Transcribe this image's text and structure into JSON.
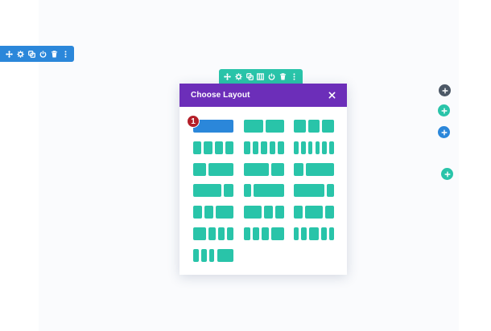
{
  "colors": {
    "section_blue": "#2b87da",
    "row_teal": "#29c4a9",
    "modal_purple": "#6c2eb9",
    "module_dark": "#4c5866",
    "badge_red": "#b41f29"
  },
  "section_toolbar": {
    "icons": [
      "move-icon",
      "gear-icon",
      "duplicate-icon",
      "power-icon",
      "trash-icon",
      "more-icon"
    ]
  },
  "row_toolbar": {
    "icons": [
      "move-icon",
      "gear-icon",
      "duplicate-icon",
      "columns-icon",
      "power-icon",
      "trash-icon",
      "more-icon"
    ]
  },
  "modal": {
    "title": "Choose Layout",
    "close_icon": "close-icon"
  },
  "badge": {
    "number": "1"
  },
  "layouts": [
    {
      "columns": [
        1
      ],
      "selected": true
    },
    {
      "columns": [
        1,
        1
      ]
    },
    {
      "columns": [
        1,
        1,
        1
      ]
    },
    {
      "columns": [
        1,
        1,
        1,
        1
      ]
    },
    {
      "columns": [
        1,
        1,
        1,
        1,
        1
      ]
    },
    {
      "columns": [
        1,
        1,
        1,
        1,
        1,
        1
      ]
    },
    {
      "columns": [
        1,
        2
      ]
    },
    {
      "columns": [
        2,
        1
      ]
    },
    {
      "columns": [
        1,
        3
      ]
    },
    {
      "columns": [
        3,
        1
      ]
    },
    {
      "columns": [
        1,
        4
      ]
    },
    {
      "columns": [
        4,
        1
      ]
    },
    {
      "columns": [
        1,
        1,
        2
      ]
    },
    {
      "columns": [
        2,
        1,
        1
      ]
    },
    {
      "columns": [
        1,
        2,
        1
      ]
    },
    {
      "columns": [
        2,
        1,
        1,
        1
      ]
    },
    {
      "columns": [
        1,
        1,
        1,
        2
      ]
    },
    {
      "columns": [
        1,
        1,
        2,
        1,
        1
      ]
    },
    {
      "columns": [
        1,
        1,
        1,
        3
      ]
    }
  ],
  "side_buttons": [
    {
      "name": "add-module-button",
      "color": "#4c5866"
    },
    {
      "name": "add-row-button",
      "color": "#29c4a9"
    },
    {
      "name": "add-section-button",
      "color": "#2b87da"
    },
    {
      "name": "add-row-button-lower",
      "color": "#29c4a9"
    }
  ]
}
